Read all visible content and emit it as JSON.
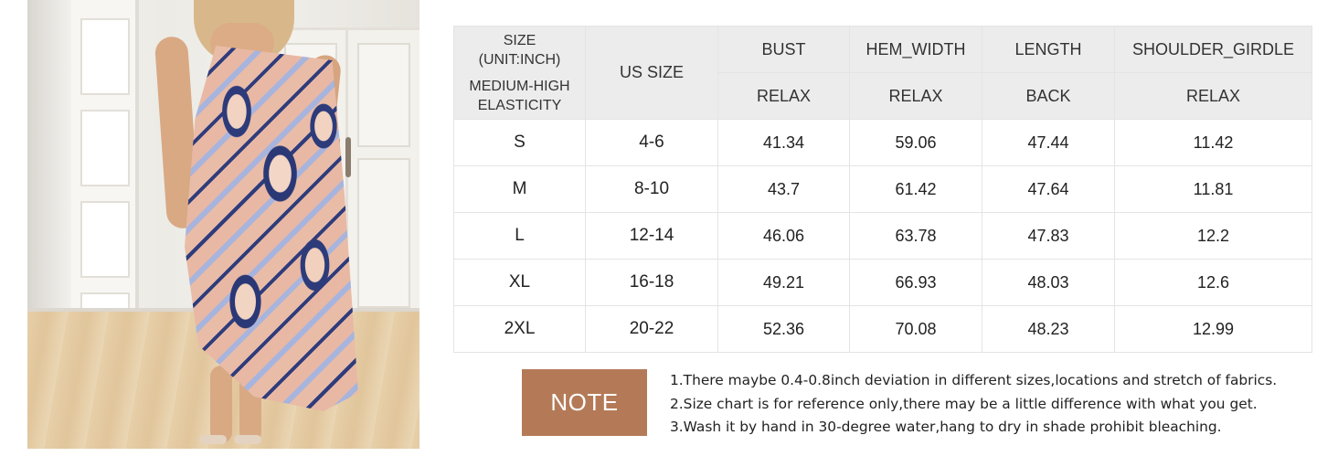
{
  "table": {
    "corner": {
      "line1": "SIZE",
      "line2": "(UNIT:INCH)",
      "line3": "MEDIUM-HIGH",
      "line4": "ELASTICITY"
    },
    "us_size_header": "US SIZE",
    "measure_headers": [
      "BUST",
      "HEM_WIDTH",
      "LENGTH",
      "SHOULDER_GIRDLE"
    ],
    "sub_headers": [
      "RELAX",
      "RELAX",
      "BACK",
      "RELAX"
    ],
    "rows": [
      {
        "size": "S",
        "us": "4-6",
        "bust": "41.34",
        "hem": "59.06",
        "length": "47.44",
        "shoulder": "11.42"
      },
      {
        "size": "M",
        "us": "8-10",
        "bust": "43.7",
        "hem": "61.42",
        "length": "47.64",
        "shoulder": "11.81"
      },
      {
        "size": "L",
        "us": "12-14",
        "bust": "46.06",
        "hem": "63.78",
        "length": "47.83",
        "shoulder": "12.2"
      },
      {
        "size": "XL",
        "us": "16-18",
        "bust": "49.21",
        "hem": "66.93",
        "length": "48.03",
        "shoulder": "12.6"
      },
      {
        "size": "2XL",
        "us": "20-22",
        "bust": "52.36",
        "hem": "70.08",
        "length": "48.23",
        "shoulder": "12.99"
      }
    ]
  },
  "note": {
    "label": "NOTE",
    "lines": [
      "1.There maybe 0.4-0.8inch deviation in different sizes,locations and stretch of fabrics.",
      "2.Size chart is for reference only,there may be a little difference with what you get.",
      "3.Wash it by hand in 30-degree water,hang to dry in shade prohibit bleaching."
    ]
  },
  "colors": {
    "header_bg": "#ececec",
    "note_bg": "#b47a57",
    "border": "#e4e4e4"
  }
}
